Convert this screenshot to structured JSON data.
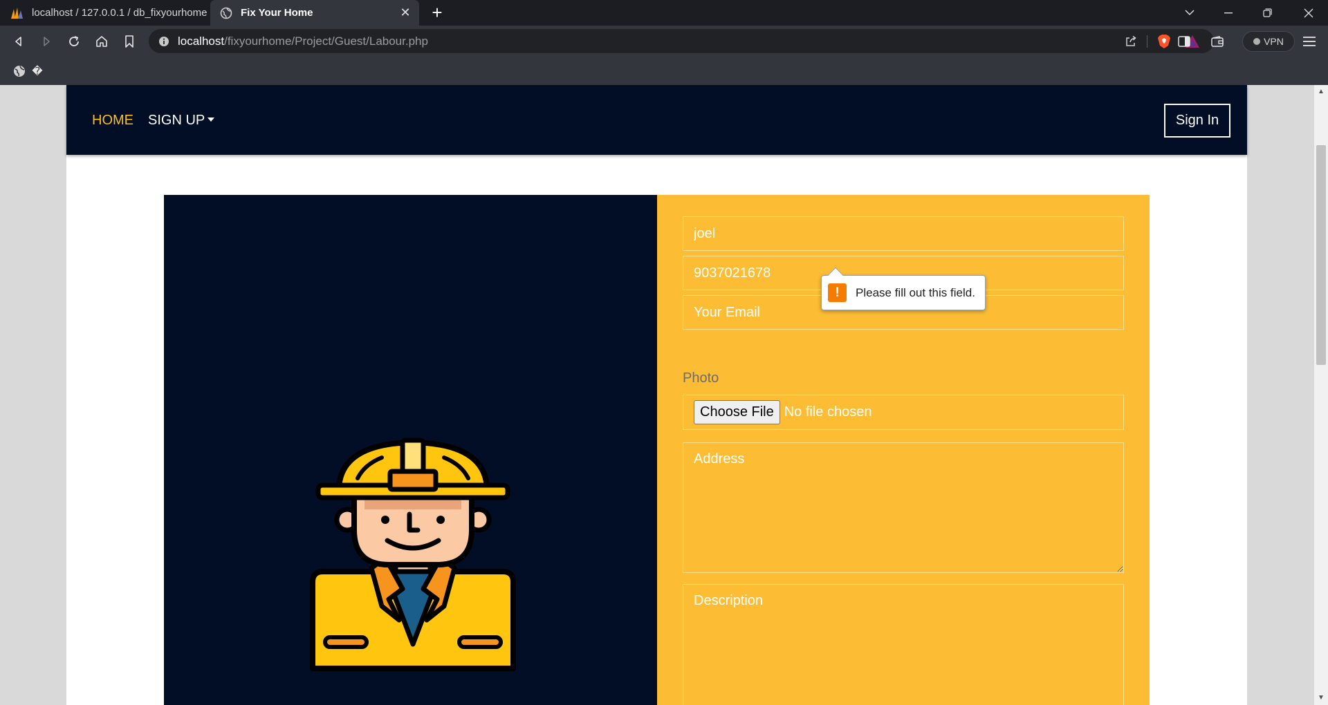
{
  "browser": {
    "tabs": [
      {
        "title": "localhost / 127.0.0.1 / db_fixyourhome",
        "active": false
      },
      {
        "title": "Fix Your Home",
        "active": true
      }
    ],
    "url_host": "localhost",
    "url_path": "/fixyourhome/Project/Guest/Labour.php",
    "vpn_label": "VPN",
    "bookmark_glyph": "�"
  },
  "nav": {
    "home": "HOME",
    "signup": "SIGN UP",
    "signin": "Sign In"
  },
  "form": {
    "name_value": "joel",
    "phone_value": "9037021678",
    "email_placeholder": "Your Email",
    "photo_label": "Photo",
    "choose_file": "Choose File",
    "no_file": "No file chosen",
    "address_placeholder": "Address",
    "description_placeholder": "Description"
  },
  "validation": {
    "message": "Please fill out this field.",
    "icon": "!"
  },
  "colors": {
    "nav_bg": "#020e26",
    "accent": "#fbbf24",
    "form_bg": "#fcbd34",
    "warning": "#f57c00"
  },
  "icons": [
    "back-icon",
    "forward-icon",
    "reload-icon",
    "home-icon",
    "bookmark-icon",
    "info-icon",
    "share-icon",
    "brave-shield-icon",
    "brave-rewards-icon",
    "sidebar-icon",
    "wallet-icon",
    "menu-icon",
    "globe-icon",
    "worker-illustration"
  ]
}
